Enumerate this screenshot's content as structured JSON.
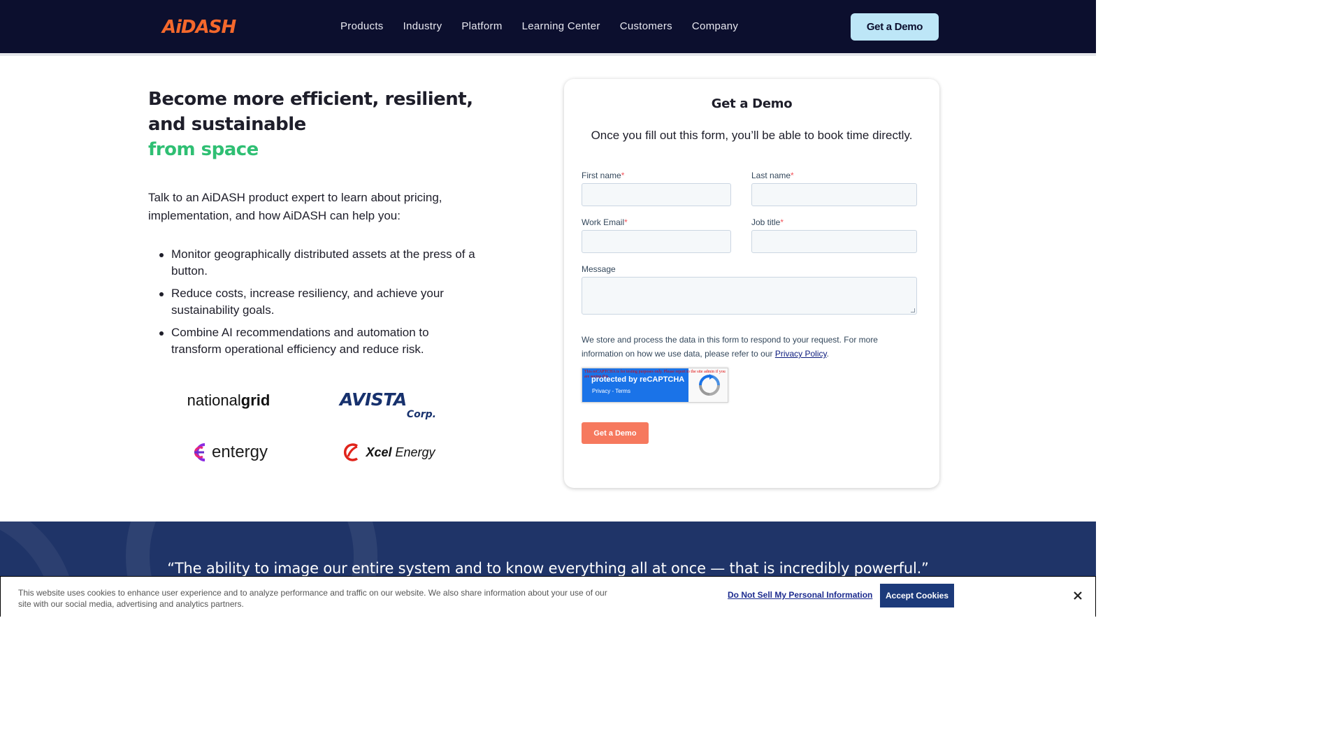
{
  "nav": {
    "logo": "AiDASH",
    "items": [
      "Products",
      "Industry",
      "Platform",
      "Learning Center",
      "Customers",
      "Company"
    ],
    "cta_label": "Get a Demo"
  },
  "hero": {
    "headline": "Become more efficient, resilient, and sustainable",
    "headline_accent": "from space",
    "intro": "Talk to an AiDASH product expert to learn about pricing, implementation, and how AiDASH can help you:",
    "bullets": [
      "Monitor geographically distributed assets at the press of a button.",
      "Reduce costs, increase resiliency, and achieve your sustainability goals.",
      "Combine AI recommendations and automation to transform operational efficiency and reduce risk."
    ]
  },
  "clients": {
    "national_grid": {
      "part1": "national",
      "part2": "grid"
    },
    "avista": {
      "main": "AVISTA",
      "corp": "Corp."
    },
    "entergy": "entergy",
    "xcel": {
      "bold": "Xcel",
      "rest": " Energy"
    }
  },
  "form": {
    "title": "Get a Demo",
    "subtitle": "Once you fill out this form, you’ll be able to book time directly.",
    "first_name_label": "First name",
    "last_name_label": "Last name",
    "work_email_label": "Work Email",
    "job_title_label": "Job title",
    "message_label": "Message",
    "required_mark": "*",
    "privacy_text": "We store and process the data in this form to respond to your request. For more information on how we use data, please refer to our ",
    "privacy_link": "Privacy Policy",
    "privacy_end": ".",
    "recaptcha_error": "This reCAPTCHA is for testing purposes only. Please report to the site admin if you are seeing this.",
    "recaptcha_main": "protected by reCAPTCHA",
    "recaptcha_links": "Privacy - Terms",
    "submit_label": "Get a Demo"
  },
  "testimonial": {
    "quote": "“The ability to image our entire system and to know everything all at once — that is incredibly powerful.”"
  },
  "cookie": {
    "text": "This website uses cookies to enhance user experience and to analyze performance and traffic on our website. We also share information about your use of our site with our social media, advertising and analytics partners.",
    "do_not_sell_label": "Do Not Sell My Personal Information",
    "accept_label": "Accept Cookies"
  },
  "colors": {
    "nav_bg": "#0c0f2e",
    "brand_orange": "#f4682c",
    "accent_green": "#2fbf73",
    "cta_light_blue": "#bde6f7",
    "submit_orange": "#f6795e",
    "testimonial_bg": "#1f3468"
  }
}
